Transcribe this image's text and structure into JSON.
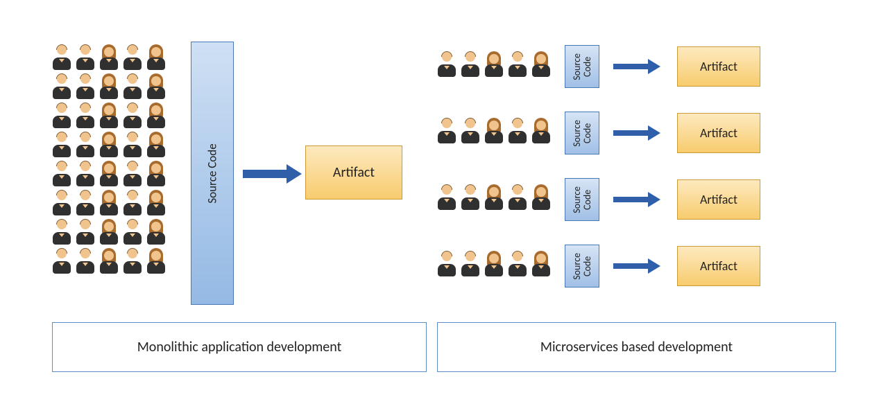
{
  "monolith": {
    "source_label": "Source Code",
    "artifact_label": "Artifact",
    "caption": "Monolithic application development",
    "team_rows": 8,
    "team_cols": 5
  },
  "microservices": {
    "caption": "Microservices based development",
    "rows": [
      {
        "source_label": "Source Code",
        "artifact_label": "Artifact"
      },
      {
        "source_label": "Source Code",
        "artifact_label": "Artifact"
      },
      {
        "source_label": "Source Code",
        "artifact_label": "Artifact"
      },
      {
        "source_label": "Source Code",
        "artifact_label": "Artifact"
      }
    ],
    "team_cols": 5
  }
}
